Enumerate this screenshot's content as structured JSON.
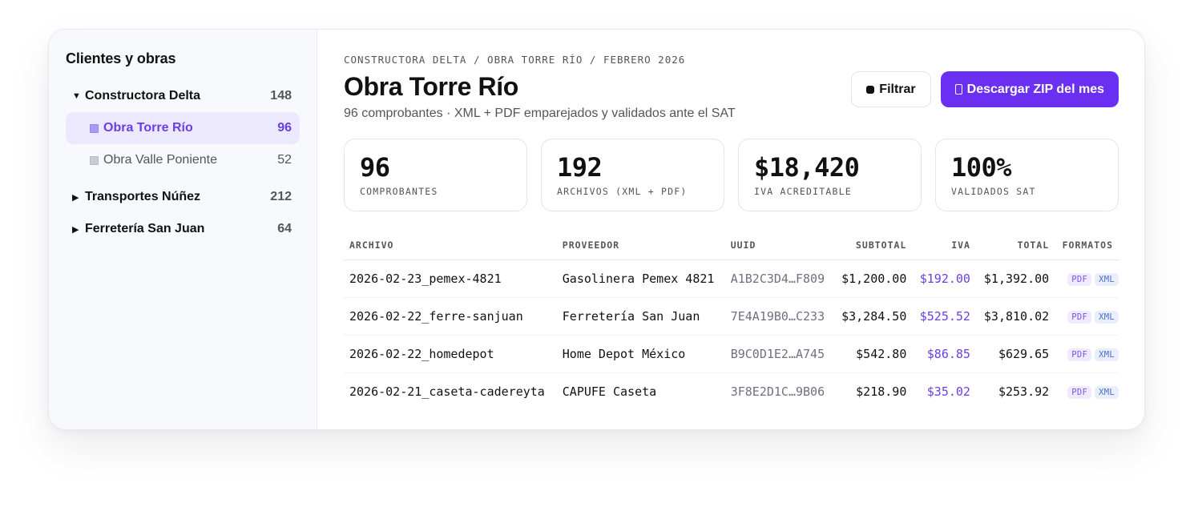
{
  "sidebar": {
    "title": "Clientes y obras",
    "clients": [
      {
        "name": "Constructora Delta",
        "count": "148",
        "expanded": true,
        "children": [
          {
            "name": "Obra Torre Río",
            "count": "96",
            "active": true
          },
          {
            "name": "Obra Valle Poniente",
            "count": "52",
            "active": false
          }
        ]
      },
      {
        "name": "Transportes Núñez",
        "count": "212",
        "expanded": false
      },
      {
        "name": "Ferretería San Juan",
        "count": "64",
        "expanded": false
      }
    ]
  },
  "main": {
    "breadcrumb": "CONSTRUCTORA DELTA / OBRA TORRE RÍO / FEBRERO 2026",
    "title": "Obra Torre Río",
    "subtitle": "96 comprobantes · XML + PDF emparejados y validados ante el SAT",
    "filter_label": "Filtrar",
    "zip_label": "Descargar ZIP del mes",
    "accent_color": "#6a2ff0",
    "stats": [
      {
        "value": "96",
        "label": "COMPROBANTES"
      },
      {
        "value": "192",
        "label": "ARCHIVOS (XML + PDF)"
      },
      {
        "value": "$18,420",
        "label": "IVA ACREDITABLE"
      },
      {
        "value": "100%",
        "label": "VALIDADOS SAT"
      }
    ],
    "table": {
      "headers": [
        "ARCHIVO",
        "PROVEEDOR",
        "UUID",
        "SUBTOTAL",
        "IVA",
        "TOTAL",
        "FORMATOS"
      ],
      "rows": [
        {
          "archivo": "2026-02-23_pemex-4821",
          "proveedor": "Gasolinera Pemex 4821",
          "uuid": "A1B2C3D4…F809",
          "subtotal": "$1,200.00",
          "iva": "$192.00",
          "total": "$1,392.00",
          "formats": [
            "PDF",
            "XML"
          ]
        },
        {
          "archivo": "2026-02-22_ferre-sanjuan",
          "proveedor": "Ferretería San Juan",
          "uuid": "7E4A19B0…C233",
          "subtotal": "$3,284.50",
          "iva": "$525.52",
          "total": "$3,810.02",
          "formats": [
            "PDF",
            "XML"
          ]
        },
        {
          "archivo": "2026-02-22_homedepot",
          "proveedor": "Home Depot México",
          "uuid": "B9C0D1E2…A745",
          "subtotal": "$542.80",
          "iva": "$86.85",
          "total": "$629.65",
          "formats": [
            "PDF",
            "XML"
          ]
        },
        {
          "archivo": "2026-02-21_caseta-cadereyta",
          "proveedor": "CAPUFE Caseta",
          "uuid": "3F8E2D1C…9B06",
          "subtotal": "$218.90",
          "iva": "$35.02",
          "total": "$253.92",
          "formats": [
            "PDF",
            "XML"
          ]
        }
      ]
    }
  }
}
